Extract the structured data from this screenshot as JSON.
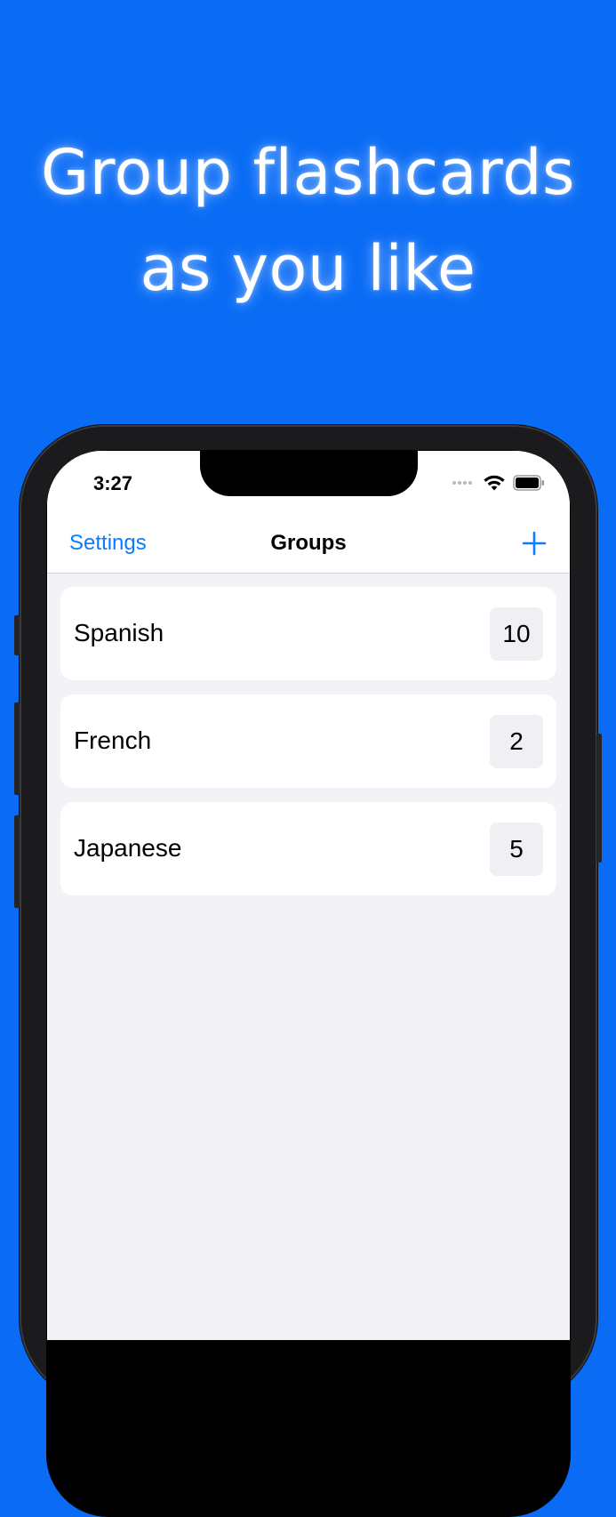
{
  "headline": {
    "line1": "Group flashcards",
    "line2": "as you like"
  },
  "status_bar": {
    "time": "3:27",
    "icons": [
      "cellular-dots-icon",
      "wifi-icon",
      "battery-icon"
    ]
  },
  "navbar": {
    "left_button": "Settings",
    "title": "Groups",
    "right_button_icon": "plus-icon"
  },
  "groups": [
    {
      "name": "Spanish",
      "count": "10"
    },
    {
      "name": "French",
      "count": "2"
    },
    {
      "name": "Japanese",
      "count": "5"
    }
  ],
  "colors": {
    "background": "#0a6cf5",
    "accent": "#0a7aff",
    "list_background": "#f2f2f7"
  }
}
